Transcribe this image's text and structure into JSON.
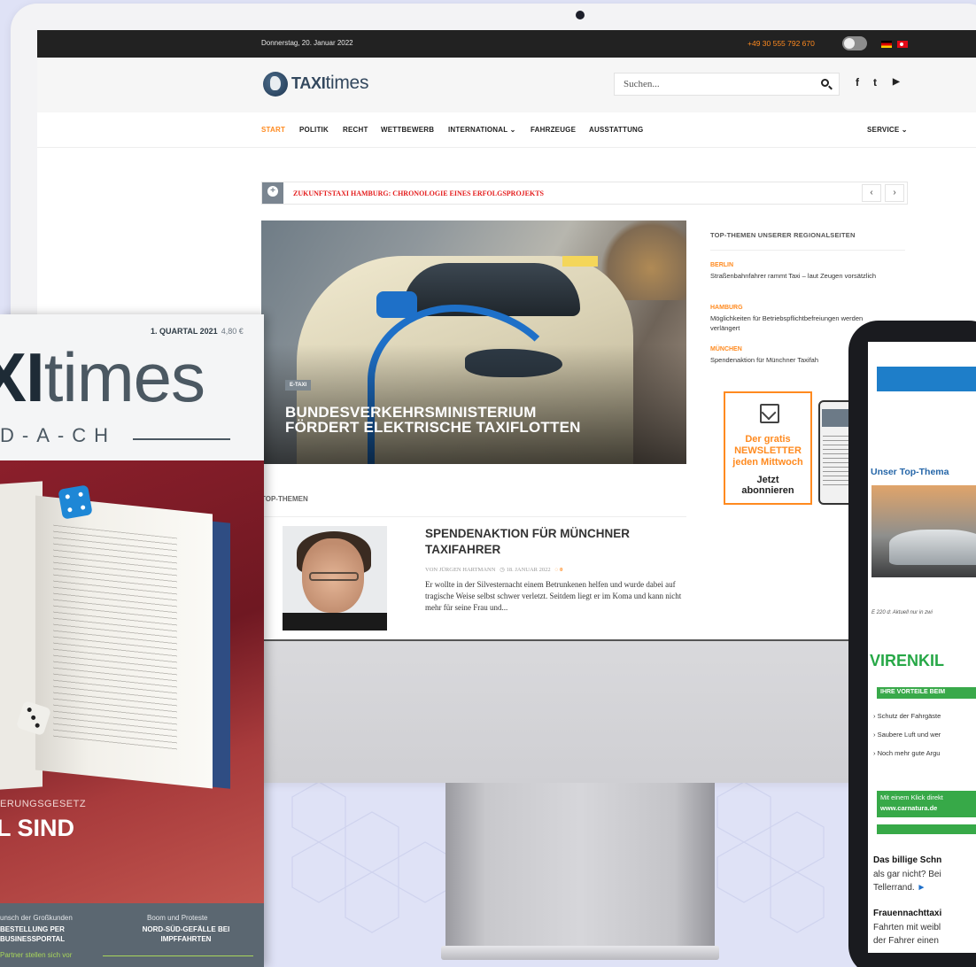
{
  "site": {
    "topbar": {
      "date": "Donnerstag, 20. Januar 2022",
      "phone": "+49 30 555 792 670"
    },
    "logo": {
      "bold": "TAXI",
      "light": "times"
    },
    "search": {
      "placeholder": "Suchen..."
    },
    "social": {
      "facebook": "f",
      "twitter": "t",
      "youtube": "▶"
    },
    "nav": [
      "START",
      "POLITIK",
      "RECHT",
      "WETTBEWERB",
      "INTERNATIONAL ⌄",
      "FAHRZEUGE",
      "AUSSTATTUNG"
    ],
    "nav_right": "SERVICE ⌄",
    "ticker": {
      "text": "ZUKUNFTSTAXI HAMBURG: CHRONOLOGIE EINES ERFOLGSPROJEKTS",
      "prev": "‹",
      "next": "›"
    },
    "hero": {
      "category": "E-TAXI",
      "title_line1": "BUNDESVERKEHRSMINISTERIUM",
      "title_line2": "FÖRDERT ELEKTRISCHE TAXIFLOTTEN"
    },
    "regional": {
      "heading": "TOP-THEMEN UNSERER REGIONALSEITEN",
      "items": [
        {
          "city": "BERLIN",
          "text": "Straßenbahnfahrer rammt Taxi – laut Zeugen vorsätzlich"
        },
        {
          "city": "HAMBURG",
          "text": "Möglichkeiten für Betriebspflichtbefreiungen werden verlängert"
        },
        {
          "city": "MÜNCHEN",
          "text": "Spendenaktion für Münchner Taxifah"
        }
      ]
    },
    "promo": {
      "line1": "Der gratis",
      "line2": "NEWSLETTER",
      "line3": "jeden Mittwoch",
      "cta1": "Jetzt",
      "cta2": "abonnieren"
    },
    "top_themen": {
      "label": "TOP-THEMEN",
      "article": {
        "title_line1": "SPENDENAKTION FÜR MÜNCHNER",
        "title_line2": "TAXIFAHRER",
        "author": "VON JÜRGEN HARTMANN",
        "date": "18. JANUAR 2022",
        "comments": "0",
        "excerpt": "Er wollte in der Silvesternacht einem Betrunkenen helfen und wurde dabei auf tragische Weise selbst schwer verletzt. Seitdem liegt er im Koma und kann nicht mehr für seine Frau und..."
      }
    }
  },
  "magazine": {
    "issue": "1. QUARTAL 2021",
    "price": "4,80 €",
    "title_bold": "XI",
    "title_light": "times",
    "subtitle": "D-A-CH",
    "kicker": "ERUNGSGESETZ",
    "headline": "L SIND",
    "footer": {
      "col1_top": "unsch der Großkunden",
      "col1_bold1": "BESTELLUNG PER",
      "col1_bold2": "BUSINESSPORTAL",
      "col2_top": "Boom und Proteste",
      "col2_bold1": "NORD-SÜD-GEFÄLLE BEI",
      "col2_bold2": "IMPFFAHRTEN",
      "green": "Partner stellen sich vor"
    }
  },
  "tablet": {
    "top_label": "Unser Top-Thema",
    "caption": "E 220 d: Aktuell nur in zwi",
    "viren": "VIRENKIL",
    "vorteile": "IHRE VORTEILE BEIM",
    "bullets": [
      "› Schutz der Fahrgäste",
      "› Saubere Luft und wer",
      "› Noch mehr gute Argu"
    ],
    "click_line1": "Mit einem Klick direkt",
    "click_line2": "www.carnatura.de",
    "news": [
      {
        "title": "Das billige Schn",
        "line1": "als gar nicht? Bei",
        "line2": "Tellerrand."
      },
      {
        "title": "Frauennachttaxi",
        "line1": "Fahrten mit weibl",
        "line2": "der Fahrer einen"
      }
    ]
  }
}
